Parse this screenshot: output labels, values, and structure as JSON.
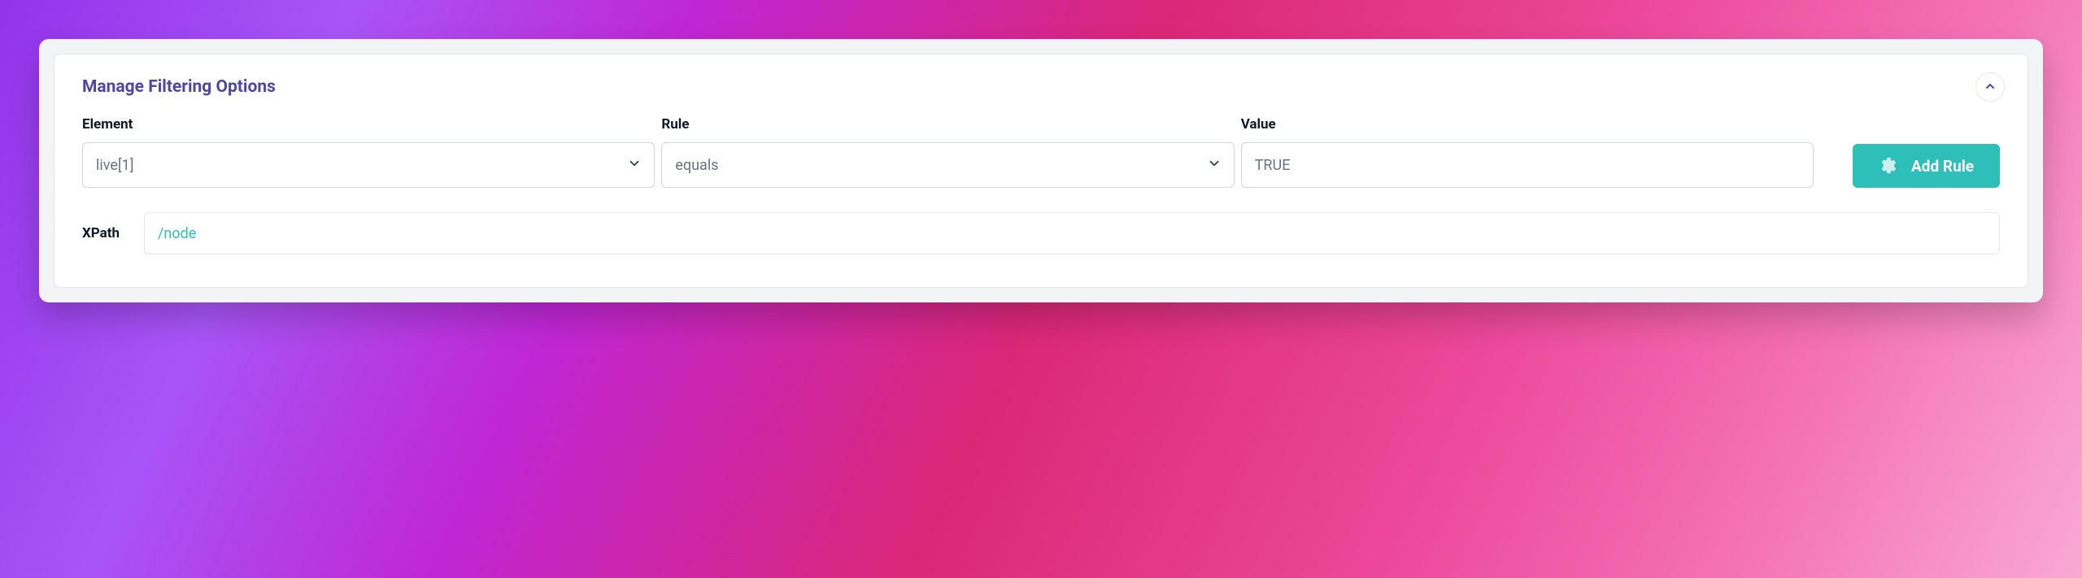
{
  "panel": {
    "title": "Manage Filtering Options"
  },
  "labels": {
    "element": "Element",
    "rule": "Rule",
    "value": "Value",
    "xpath": "XPath"
  },
  "fields": {
    "element_value": "live[1]",
    "rule_value": "equals",
    "value_value": "TRUE",
    "xpath_value": "/node"
  },
  "buttons": {
    "add_rule": "Add Rule"
  }
}
